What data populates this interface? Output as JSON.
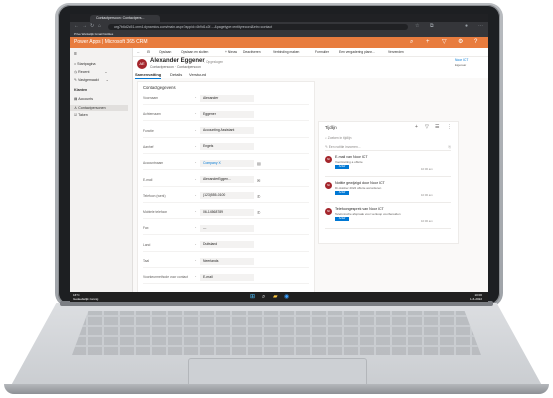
{
  "browser": {
    "tab_title": "Contactpersoon: Contactpers...",
    "url": "org7b6d2c51.crm4.dynamics.com/main.aspx?appid=4b9d1c2f-...&pagetype=entityrecord&etn=contact",
    "bookmarks": "Prive  Werkelijk   Gmail   Notities"
  },
  "app": {
    "title": "Power Apps  |  Microsoft 365 CRM",
    "brand_color": "#e87c3e"
  },
  "sidebar": {
    "items": [
      {
        "label": "≡"
      },
      {
        "label": "Startpagina"
      },
      {
        "label": "Recent"
      },
      {
        "label": "Vastgemaakt"
      },
      {
        "label": "Klanten"
      },
      {
        "label": "Accounts"
      },
      {
        "label": "Contactpersonen"
      },
      {
        "label": "Taken"
      }
    ]
  },
  "command_bar": {
    "items": [
      "←",
      "⊟",
      "Opslaan",
      "Opslaan en sluiten",
      "+ Nieuw",
      "Deactiveren",
      "Verbinding maken",
      "Formulier",
      "Een vergadering plann...",
      "Verzenden"
    ]
  },
  "record": {
    "initials": "AE",
    "name": "Alexander Eggener",
    "saved_status": "- Opgeslagen",
    "type": "Contactpersoon · Contactpersoon",
    "owner_name": "Noor ICT",
    "owner_label": "Eigenaar"
  },
  "record_tabs": [
    "Samenvatting",
    "Details",
    "Verstuurd"
  ],
  "contact_card": {
    "title": "Contactgegevens",
    "fields": [
      {
        "label": "Voornaam",
        "value": "Alexander"
      },
      {
        "label": "Achternaam",
        "value": "Eggener"
      },
      {
        "label": "Functie",
        "value": "Accounting Assistant"
      },
      {
        "label": "Aanhef",
        "value": "Engels"
      },
      {
        "label": "Accountnaam",
        "value": "Company X"
      },
      {
        "label": "E-mail",
        "value": "AlexanderEggen..."
      },
      {
        "label": "Telefoon (werk)",
        "value": "(123)555-0100"
      },
      {
        "label": "Mobiele telefoon",
        "value": "06-14568789"
      },
      {
        "label": "Fax",
        "value": "---"
      },
      {
        "label": "Land",
        "value": "Duitsland"
      },
      {
        "label": "Taal",
        "value": "Neerlands"
      },
      {
        "label": "Voorkeurmethode voor contact",
        "value": "E-mail"
      }
    ]
  },
  "timeline": {
    "title": "Tijdlijn",
    "search_placeholder": "Zoeken in tijdlijn",
    "note_placeholder": "Een notitie invoeren...",
    "items": [
      {
        "initials": "NI",
        "heading": "E-mail van Noor ICT",
        "sub": "Voortzetting a offerte",
        "badge": "Actief",
        "date": "10:00 am"
      },
      {
        "initials": "NI",
        "heading": "Notitie gewijzigd door Noor ICT",
        "sub": "Di oktober 2022 offerte accorderen",
        "badge": "Actief",
        "date": "10:00 am"
      },
      {
        "initials": "NI",
        "heading": "Telefoongesprek van Noor ICT",
        "sub": "Telefonische afspraak voor verkoop voorbereiden",
        "badge": "Actief",
        "date": "10:00 am"
      }
    ]
  },
  "taskbar": {
    "weather_temp": "16°C",
    "weather_text": "Gedeeltelijk zonnig",
    "time": "10:00",
    "date": "1-6-2022"
  }
}
